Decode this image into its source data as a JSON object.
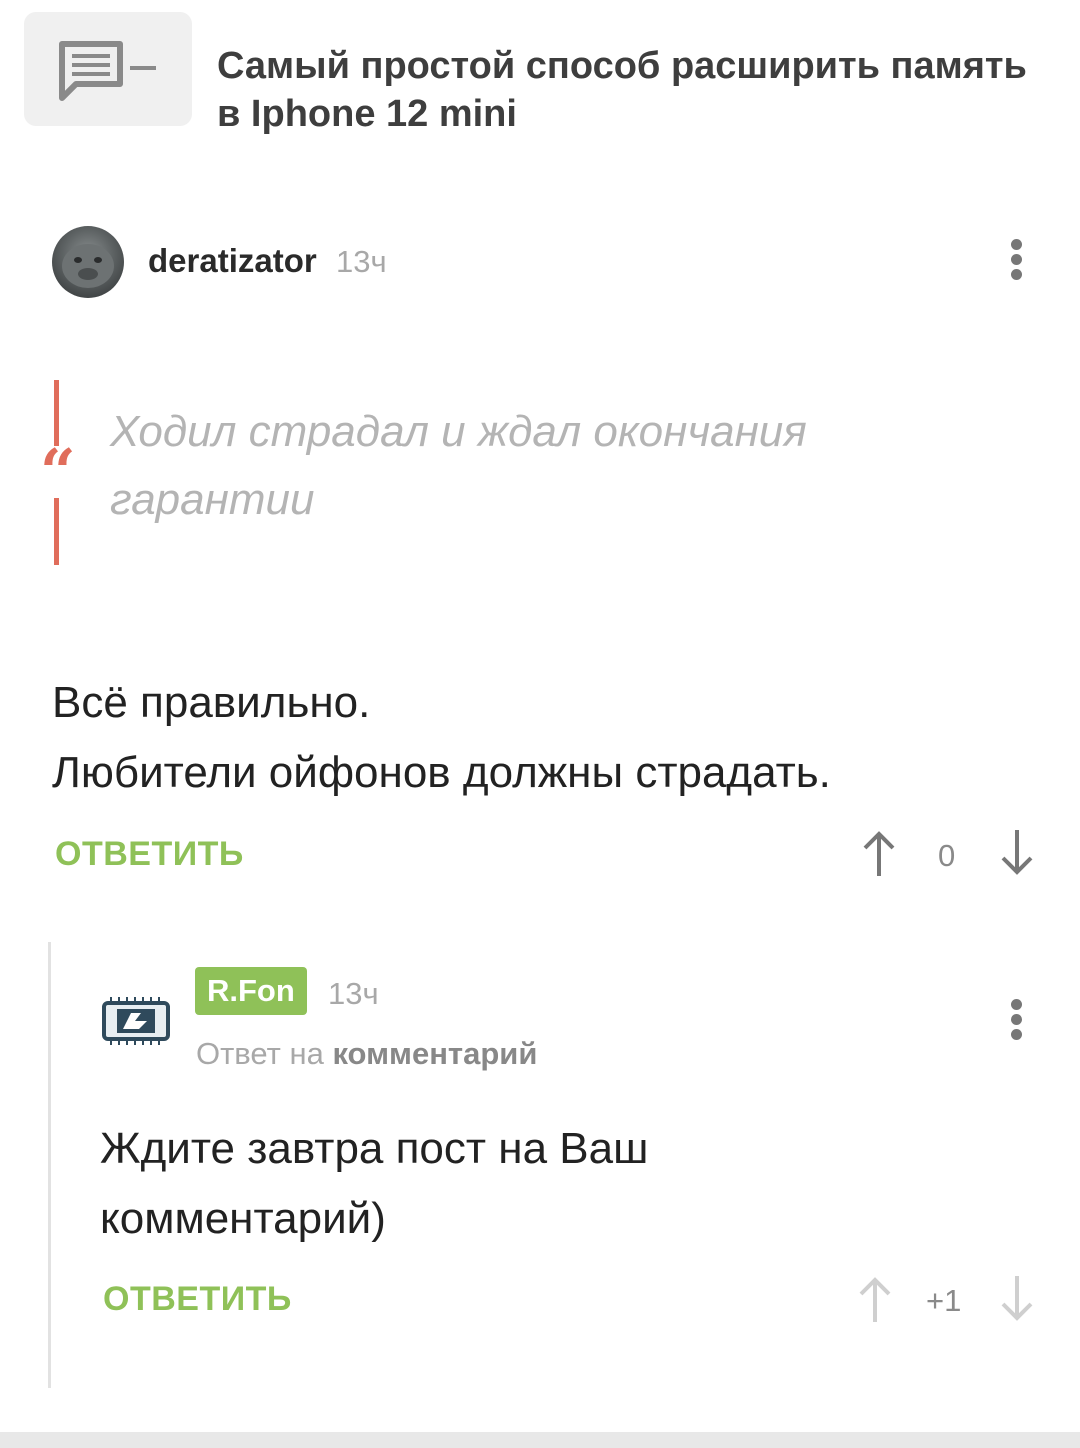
{
  "post": {
    "title": "Самый простой способ расширить память в Iphone 12 mini",
    "thumb_icon": "comment-icon"
  },
  "comment": {
    "username": "deratizator",
    "time": "13ч",
    "quote": "Ходил страдал и ждал окончания гарантии",
    "line1": "Всё правильно.",
    "line2": "Любители ойфонов должны страдать.",
    "reply_label": "ОТВЕТИТЬ",
    "rating": "0"
  },
  "reply": {
    "username": "R.Fon",
    "time": "13ч",
    "reply_to_prefix": "Ответ на",
    "reply_to_target": "комментарий",
    "line1": "Ждите завтра пост на Ваш",
    "line2": "комментарий)",
    "reply_label": "ОТВЕТИТЬ",
    "rating": "+1"
  },
  "colors": {
    "accent_green": "#8fc158",
    "quote_red": "#e06d5b"
  }
}
